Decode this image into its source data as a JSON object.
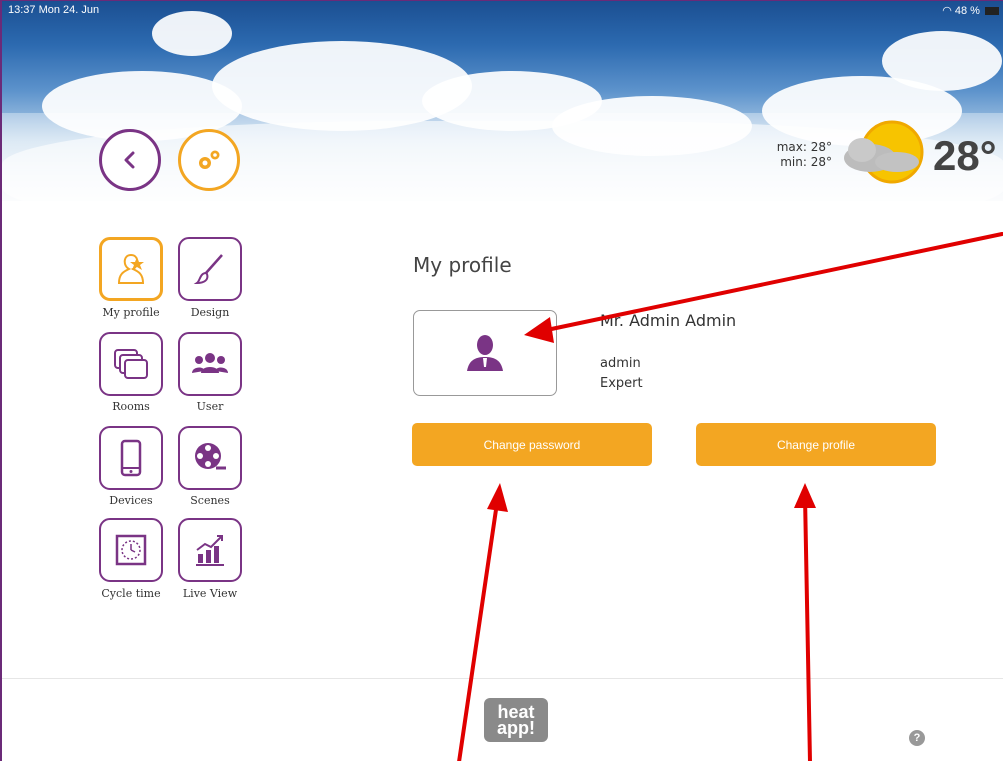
{
  "status_bar": {
    "time_date": "13:37  Mon 24. Jun",
    "battery": "48 %"
  },
  "weather": {
    "max": "max: 28°",
    "min": "min: 28°",
    "temperature": "28°"
  },
  "sidebar": {
    "items": [
      {
        "label": "My profile",
        "icon": "profile-star-icon",
        "active": true
      },
      {
        "label": "Design",
        "icon": "brush-icon",
        "active": false
      },
      {
        "label": "Rooms",
        "icon": "rooms-icon",
        "active": false
      },
      {
        "label": "User",
        "icon": "users-icon",
        "active": false
      },
      {
        "label": "Devices",
        "icon": "phone-icon",
        "active": false
      },
      {
        "label": "Scenes",
        "icon": "film-reel-icon",
        "active": false
      },
      {
        "label": "Cycle time",
        "icon": "clock-icon",
        "active": false
      },
      {
        "label": "Live View",
        "icon": "chart-icon",
        "active": false
      }
    ]
  },
  "main": {
    "title": "My profile",
    "name": "Mr. Admin Admin",
    "login": "admin",
    "role": "Expert",
    "change_password_label": "Change password",
    "change_profile_label": "Change profile"
  },
  "footer": {
    "logo_text": "heat app!",
    "help": "?"
  },
  "colors": {
    "accent": "#f3a622",
    "brand": "#7a3485",
    "annotation": "#e00000"
  }
}
